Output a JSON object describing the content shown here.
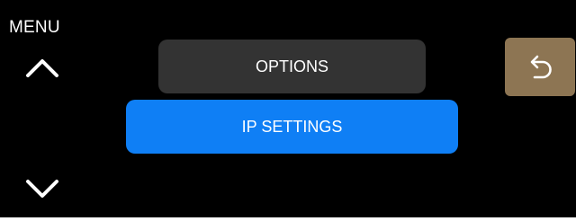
{
  "header": {
    "menu_label": "MENU"
  },
  "navigation": {
    "up_icon": "chevron-up-icon",
    "down_icon": "chevron-down-icon"
  },
  "menu": {
    "items": [
      {
        "label": "OPTIONS",
        "state": "normal"
      },
      {
        "label": "IP SETTINGS",
        "state": "selected"
      }
    ]
  },
  "back_button": {
    "icon": "undo-arrow-icon"
  },
  "colors": {
    "background": "#000000",
    "button_normal": "#333333",
    "button_selected": "#0f7ff5",
    "back_button": "#8d7553",
    "text": "#ffffff"
  }
}
